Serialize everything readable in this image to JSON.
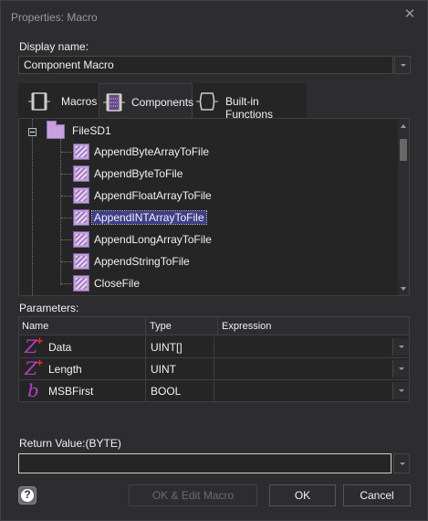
{
  "window": {
    "title": "Properties: Macro"
  },
  "display_name": {
    "label": "Display name:",
    "value": "Component Macro"
  },
  "tabs": [
    {
      "label": "Macros",
      "icon": "macro-block-icon",
      "active": false
    },
    {
      "label": "Components",
      "icon": "component-block-icon",
      "active": true
    },
    {
      "label": "Built-in Functions",
      "icon": "function-block-icon",
      "active": false
    }
  ],
  "tree": {
    "folder": "FileSD1",
    "items": [
      {
        "label": "AppendByteArrayToFile",
        "selected": false
      },
      {
        "label": "AppendByteToFile",
        "selected": false
      },
      {
        "label": "AppendFloatArrayToFile",
        "selected": false
      },
      {
        "label": "AppendINTArrayToFile",
        "selected": true
      },
      {
        "label": "AppendLongArrayToFile",
        "selected": false
      },
      {
        "label": "AppendStringToFile",
        "selected": false
      },
      {
        "label": "CloseFile",
        "selected": false
      }
    ]
  },
  "parameters": {
    "label": "Parameters:",
    "headers": [
      "Name",
      "Type",
      "Expression"
    ],
    "rows": [
      {
        "icon": "Z",
        "name": "Data",
        "type": "UINT[]",
        "expression": ""
      },
      {
        "icon": "Z",
        "name": "Length",
        "type": "UINT",
        "expression": ""
      },
      {
        "icon": "b",
        "name": "MSBFirst",
        "type": "BOOL",
        "expression": ""
      }
    ]
  },
  "return_value": {
    "label": "Return Value:(BYTE)",
    "value": ""
  },
  "buttons": {
    "ok_edit": "OK & Edit Macro",
    "ok": "OK",
    "cancel": "Cancel"
  },
  "colors": {
    "background": "#2d2d30",
    "selection": "#3e3e8a",
    "icon_accent": "#b040c0"
  }
}
